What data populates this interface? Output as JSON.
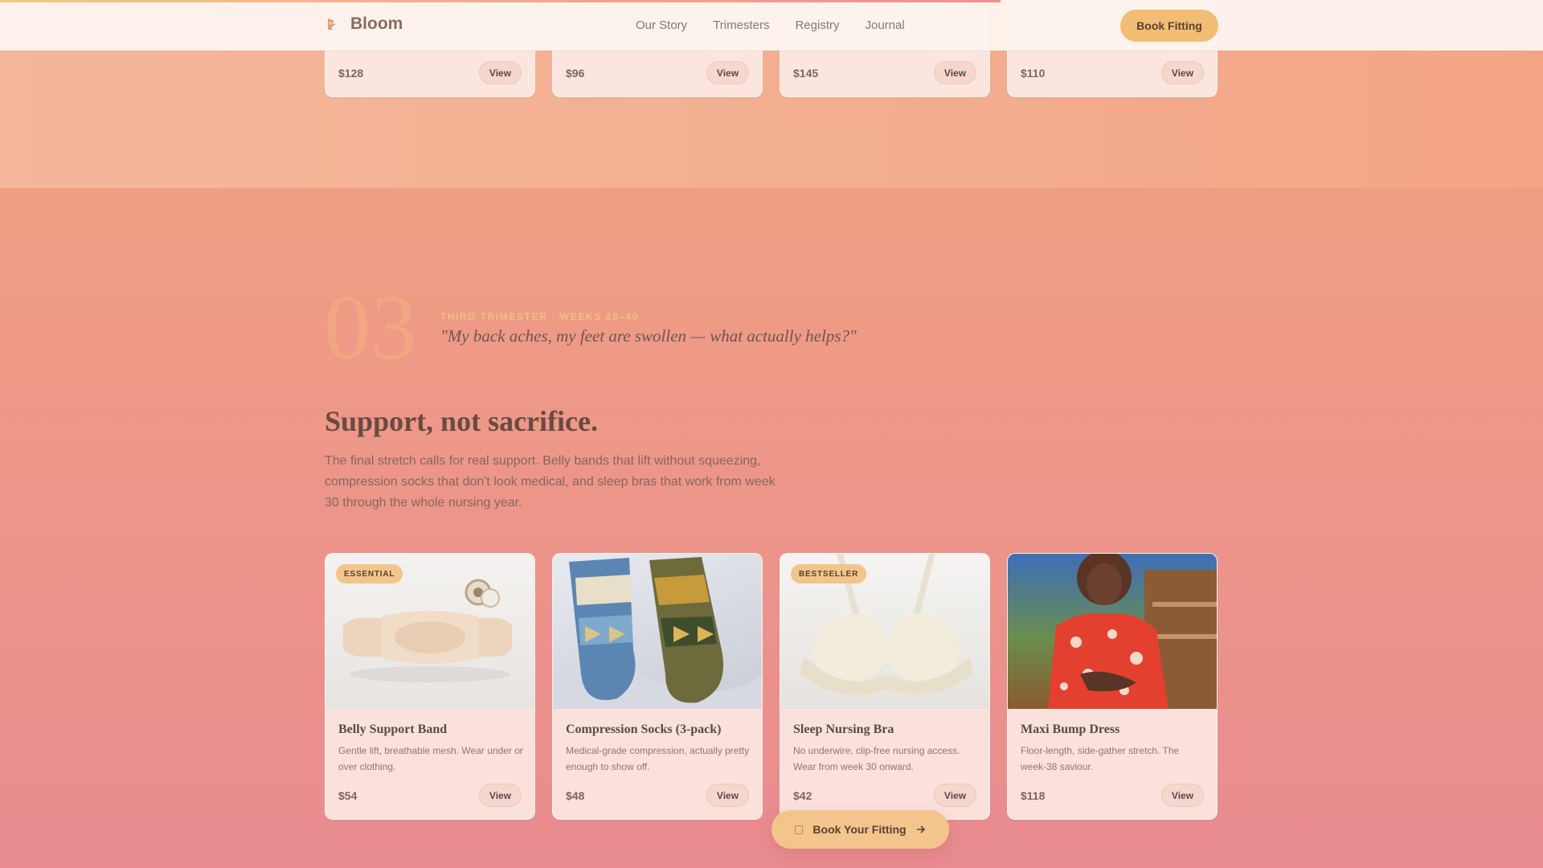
{
  "nav": {
    "brand": "Bloom",
    "links": [
      "Our Story",
      "Trimesters",
      "Registry",
      "Journal"
    ],
    "cta": "Book Fitting"
  },
  "previous_row": {
    "prices": [
      "$128",
      "$96",
      "$145",
      "$110"
    ],
    "view_label": "View"
  },
  "section": {
    "number": "03",
    "eyebrow": "THIRD TRIMESTER · WEEKS 28–40",
    "quote": "\"My back aches, my feet are swollen — what actually helps?\"",
    "headline": "Support, not sacrifice.",
    "body": "The final stretch calls for real support. Belly bands that lift without squeezing, compression socks that don't look medical, and sleep bras that work from week 30 through the whole nursing year."
  },
  "products": [
    {
      "badge": "ESSENTIAL",
      "title": "Belly Support Band",
      "desc": "Gentle lift, breathable mesh. Wear under or over clothing.",
      "price": "$54",
      "view": "View"
    },
    {
      "badge": "",
      "title": "Compression Socks (3-pack)",
      "desc": "Medical-grade compression, actually pretty enough to show off.",
      "price": "$48",
      "view": "View"
    },
    {
      "badge": "BESTSELLER",
      "title": "Sleep Nursing Bra",
      "desc": "No underwire, clip-free nursing access. Wear from week 30 onward.",
      "price": "$42",
      "view": "View"
    },
    {
      "badge": "",
      "title": "Maxi Bump Dress",
      "desc": "Floor-length, side-gather stretch. The week-38 saviour.",
      "price": "$118",
      "view": "View"
    }
  ],
  "floating_cta": {
    "label": "Book Your Fitting",
    "icon": "calendar-icon",
    "arrow": "arrow-right-icon"
  },
  "colors": {
    "accent": "#f2bd74",
    "background": "#ee9a86"
  }
}
